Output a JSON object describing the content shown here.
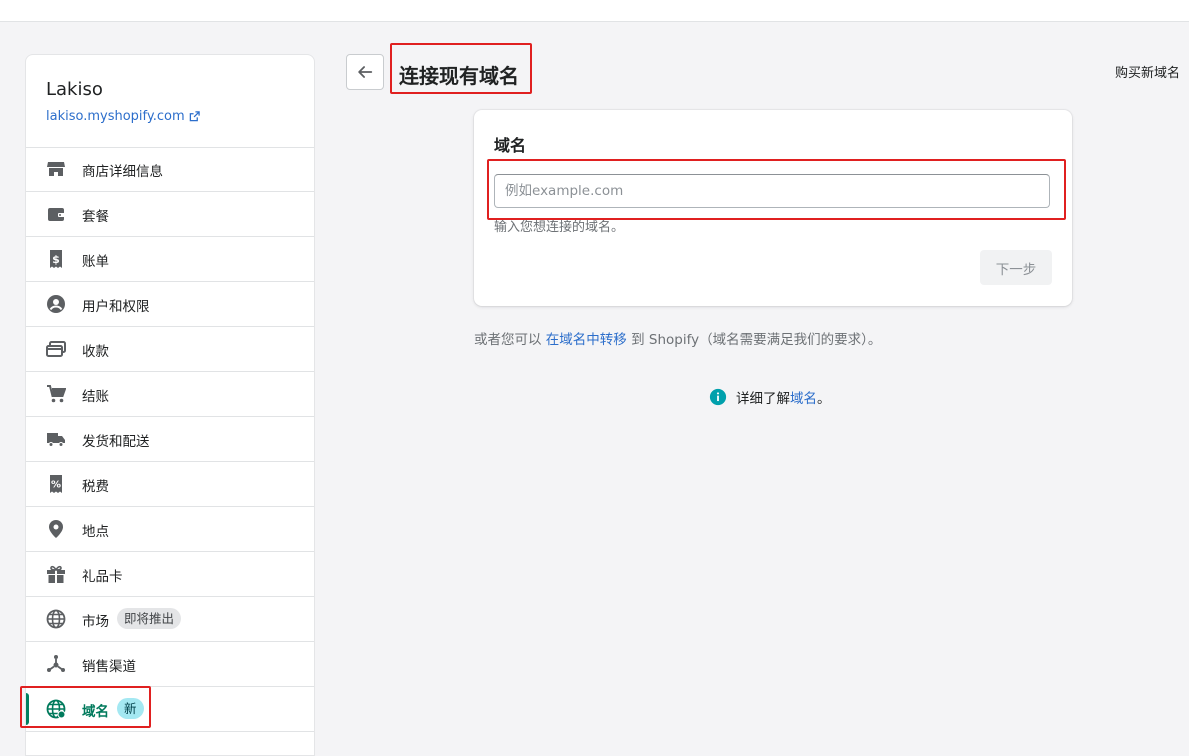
{
  "store": {
    "name": "Lakiso",
    "url": "lakiso.myshopify.com"
  },
  "nav": {
    "items": [
      {
        "label": "商店详细信息",
        "icon": "store-icon"
      },
      {
        "label": "套餐",
        "icon": "wallet-icon"
      },
      {
        "label": "账单",
        "icon": "bill-icon"
      },
      {
        "label": "用户和权限",
        "icon": "user-icon"
      },
      {
        "label": "收款",
        "icon": "payment-icon"
      },
      {
        "label": "结账",
        "icon": "cart-icon"
      },
      {
        "label": "发货和配送",
        "icon": "truck-icon"
      },
      {
        "label": "税费",
        "icon": "tax-icon"
      },
      {
        "label": "地点",
        "icon": "location-icon"
      },
      {
        "label": "礼品卡",
        "icon": "gift-icon"
      },
      {
        "label": "市场",
        "icon": "globe-icon",
        "badge": "即将推出"
      },
      {
        "label": "销售渠道",
        "icon": "channels-icon"
      },
      {
        "label": "域名",
        "icon": "domain-globe-icon",
        "badge": "新",
        "active": true
      }
    ]
  },
  "header": {
    "title": "连接现有域名",
    "buy_link": "购买新域名"
  },
  "card": {
    "title": "域名",
    "input_placeholder": "例如example.com",
    "input_value": "",
    "help_text": "输入您想连接的域名。",
    "next_label": "下一步"
  },
  "transfer": {
    "prefix": "或者您可以",
    "link": "在域名中转移",
    "suffix": "到 Shopify（域名需要满足我们的要求）。"
  },
  "learn": {
    "prefix": "详细了解",
    "link": "域名",
    "suffix": "。"
  },
  "colors": {
    "accent": "#008060",
    "link": "#2c6ecb",
    "highlight": "#e02020",
    "info": "#00a0ac"
  }
}
